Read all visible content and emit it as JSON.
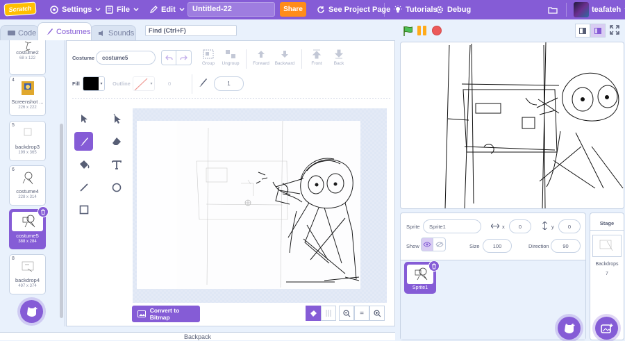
{
  "menubar": {
    "logo": "Scratch",
    "settings": "Settings",
    "file": "File",
    "edit": "Edit",
    "project_title": "Untitled-22",
    "share": "Share",
    "see_project_page": "See Project Page",
    "tutorials": "Tutorials",
    "debug": "Debug",
    "username": "teafateh"
  },
  "tabs": {
    "code": "Code",
    "costumes": "Costumes",
    "sounds": "Sounds"
  },
  "find": {
    "placeholder": "Find (Ctrl+F)"
  },
  "costumes": [
    {
      "num": "",
      "name": "costume2",
      "size": "68 x 122"
    },
    {
      "num": "4",
      "name": "Screenshot ...",
      "size": "226 x 222"
    },
    {
      "num": "5",
      "name": "backdrop3",
      "size": "199 x 365"
    },
    {
      "num": "6",
      "name": "costume4",
      "size": "228 x 314"
    },
    {
      "num": "7",
      "name": "costume5",
      "size": "388 x 284",
      "selected": true
    },
    {
      "num": "8",
      "name": "backdrop4",
      "size": "497 x 374"
    }
  ],
  "editor": {
    "costume_label": "Costume",
    "costume_name": "costume5",
    "group": "Group",
    "ungroup": "Ungroup",
    "forward": "Forward",
    "backward": "Backward",
    "front": "Front",
    "back": "Back",
    "fill_label": "Fill",
    "outline_label": "Outline",
    "outline_width": "0",
    "brush_size": "1",
    "convert": "Convert to Bitmap",
    "zoom_reset": "="
  },
  "backpack": "Backpack",
  "sprite": {
    "sprite_label": "Sprite",
    "sprite_name": "Sprite1",
    "x_label": "x",
    "x": "0",
    "y_label": "y",
    "y": "0",
    "show_label": "Show",
    "size_label": "Size",
    "size": "100",
    "direction_label": "Direction",
    "direction": "90",
    "tile_name": "Sprite1"
  },
  "stage_pane": {
    "title": "Stage",
    "backdrops_label": "Backdrops",
    "backdrops_count": "7"
  },
  "colors": {
    "accent": "#855cd6",
    "share": "#ff8c1a",
    "fill": "#000000"
  }
}
